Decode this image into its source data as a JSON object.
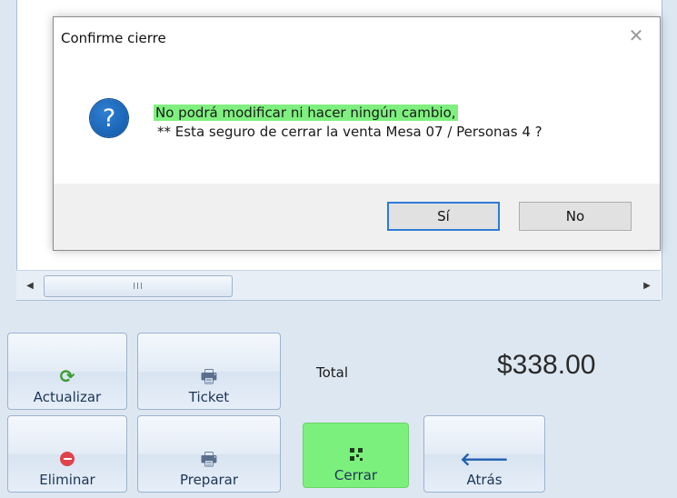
{
  "dialog": {
    "title": "Confirme cierre",
    "close_glyph": "✕",
    "message_line1": "No podrá modificar ni hacer ningún cambio,",
    "message_line2": " ** Esta seguro de cerrar la venta Mesa 07 / Personas 4 ?",
    "question_glyph": "?",
    "yes_label": "Sí",
    "no_label": "No",
    "highlight_color": "#7ff07f"
  },
  "scrollbar": {
    "left_arrow": "◀",
    "right_arrow": "▶",
    "thumb_grip": "III"
  },
  "buttons": {
    "actualizar": {
      "label": "Actualizar",
      "icon": "refresh-icon",
      "glyph": "⟳"
    },
    "ticket": {
      "label": "Ticket",
      "icon": "printer-icon",
      "glyph": "🖶"
    },
    "eliminar": {
      "label": "Eliminar",
      "icon": "delete-icon"
    },
    "preparar": {
      "label": "Preparar",
      "icon": "printer-icon",
      "glyph": "🖶"
    },
    "cerrar": {
      "label": "Cerrar",
      "icon": "qr-code-icon",
      "color": "#7cf07c"
    },
    "atras": {
      "label": "Atrás",
      "icon": "arrow-left-icon",
      "glyph": "🡐"
    }
  },
  "total": {
    "label": "Total",
    "value": "$338.00"
  }
}
